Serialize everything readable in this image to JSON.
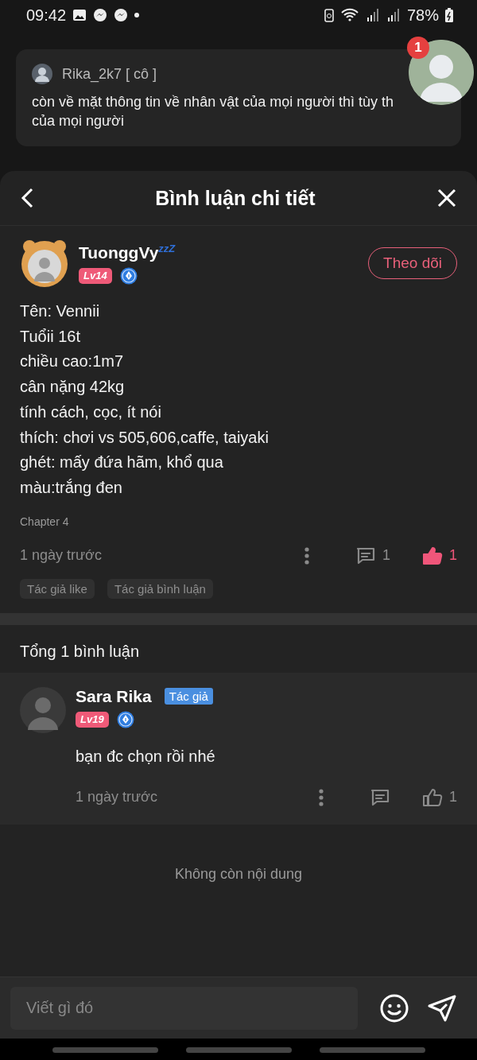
{
  "status_bar": {
    "time": "09:42",
    "battery": "78%"
  },
  "notification": {
    "sender": "Rika_2k7 [ cô ]",
    "message_lines": [
      "còn về mặt thông tin về nhân vật của mọi người thì tùy th",
      "của mọi người"
    ],
    "badge": "1"
  },
  "header": {
    "title": "Bình luận chi tiết"
  },
  "comment": {
    "author": "TuonggVy",
    "author_mark": "zzZ",
    "level": "Lv14",
    "follow": "Theo dõi",
    "lines": [
      "Tên: Vennii",
      "Tuổii 16t",
      "chiều cao:1m7",
      "cân nặng 42kg",
      "tính cách, cọc, ít nói",
      "thích: chơi vs 505,606,caffe, taiyaki",
      "ghét: mấy đứa hãm, khổ qua",
      "màu:trắng đen"
    ],
    "chapter": "Chapter 4",
    "time": "1 ngày trước",
    "reply_count": "1",
    "like_count": "1",
    "liked": true,
    "tags": [
      "Tác giả like",
      "Tác giả bình luận"
    ]
  },
  "total": "Tổng 1 bình luận",
  "replies": [
    {
      "author": "Sara Rika",
      "role": "Tác giả",
      "level": "Lv19",
      "text": "bạn đc chọn rồi nhé",
      "time": "1 ngày trước",
      "like_count": "1",
      "liked": false
    }
  ],
  "end_text": "Không còn nội dung",
  "input": {
    "placeholder": "Viết gì đó"
  }
}
